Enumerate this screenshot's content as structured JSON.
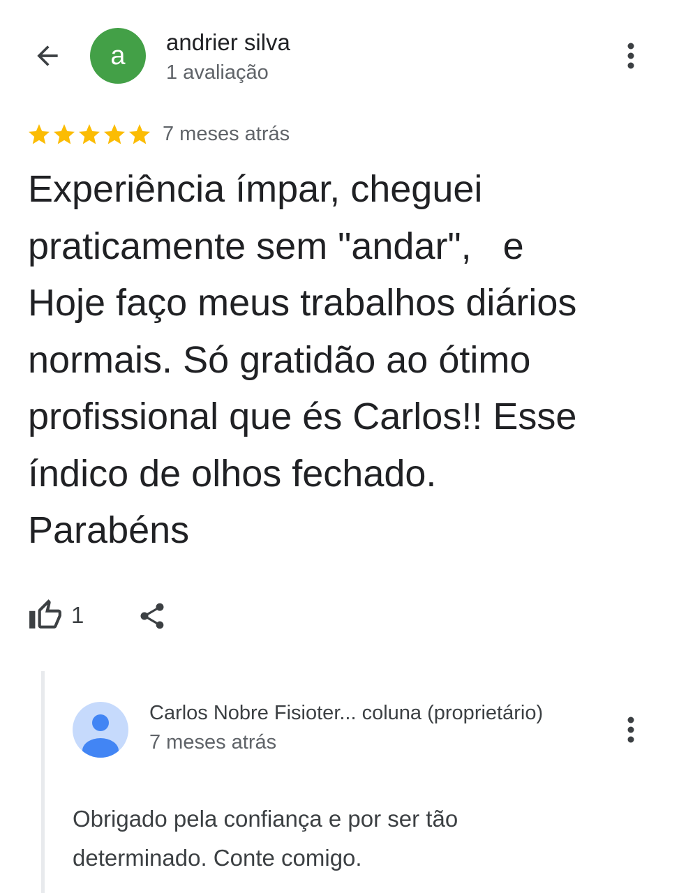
{
  "colors": {
    "avatar_bg": "#43a047",
    "star": "#fbbc04",
    "owner_avatar_bg": "#c6dafc",
    "owner_avatar_figure": "#4285f4"
  },
  "review": {
    "author": {
      "avatar_letter": "a",
      "name": "andrier silva",
      "review_count": "1 avaliação"
    },
    "rating": 5,
    "date": "7 meses atrás",
    "text_lines": [
      "Experiência ímpar, cheguei",
      "praticamente sem \"andar\",   e",
      "Hoje faço meus trabalhos diários",
      "normais. Só gratidão ao ótimo",
      "profissional que és Carlos!! Esse",
      "índico de olhos fechado.",
      "Parabéns"
    ],
    "like_count": "1"
  },
  "reply": {
    "owner_name": "Carlos Nobre Fisioter... coluna (proprietário)",
    "date": "7 meses atrás",
    "text_lines": [
      "Obrigado pela confiança e por ser tão",
      "determinado. Conte comigo."
    ]
  },
  "icons": {
    "back": "arrow-back-icon",
    "more": "more-vert-icon",
    "star": "star-icon",
    "like": "thumb-up-outline-icon",
    "share": "share-icon",
    "person": "person-icon"
  }
}
